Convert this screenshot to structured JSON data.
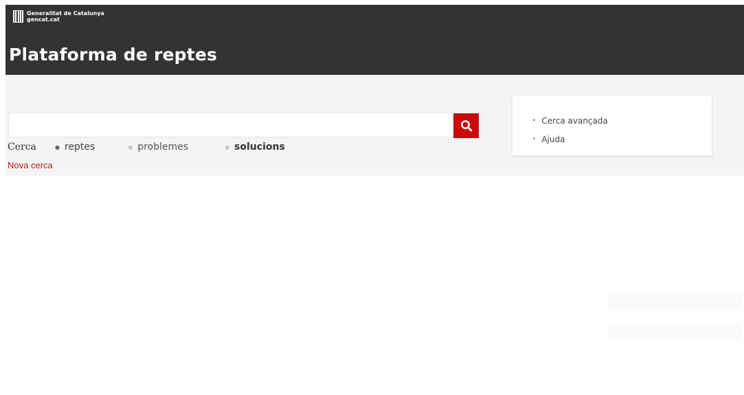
{
  "header": {
    "logo": {
      "line1": "Generalitat de Catalunya",
      "line2": "gencat.cat",
      "icon": "generalitat-logo-icon"
    },
    "title": "Plataforma de reptes"
  },
  "search": {
    "input_value": "",
    "button_icon": "search-icon",
    "scope_label": "Cerca",
    "options": [
      {
        "label": "reptes",
        "selected": true
      },
      {
        "label": "problemes",
        "selected": false
      },
      {
        "label": "solucions",
        "selected": false
      }
    ],
    "new_search": "Nova cerca"
  },
  "side_links": {
    "items": [
      {
        "label": "Cerca avançada"
      },
      {
        "label": "Ajuda"
      }
    ]
  },
  "colors": {
    "header_bg": "#333333",
    "accent": "#c80a0a",
    "band_bg": "#f4f4f4"
  }
}
